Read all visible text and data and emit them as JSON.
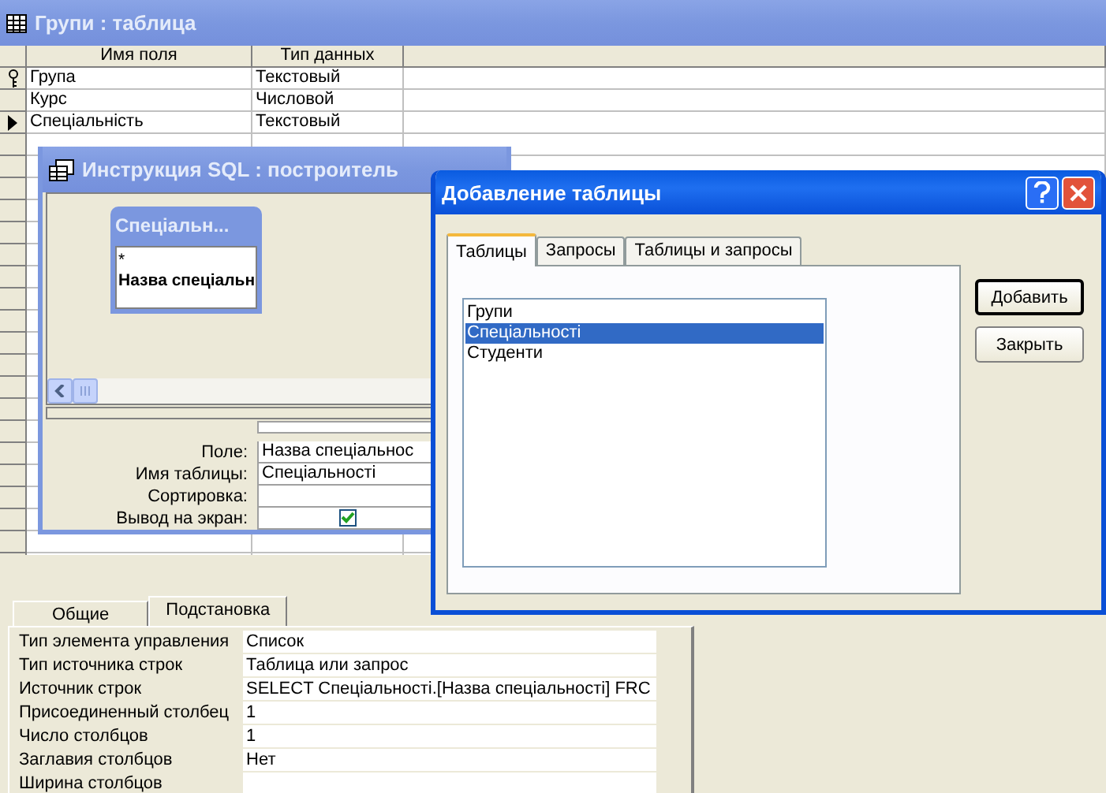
{
  "table_window": {
    "title": "Групи : таблица",
    "columns": [
      "Имя поля",
      "Тип данных"
    ],
    "rows": [
      {
        "name": "Група",
        "type": "Текстовый",
        "key": true,
        "current": false
      },
      {
        "name": "Курс",
        "type": "Числовой",
        "key": false,
        "current": false
      },
      {
        "name": "Спеціальність",
        "type": "Текстовый",
        "key": false,
        "current": true
      }
    ],
    "property_tabs": [
      {
        "label": "Общие",
        "selected": false
      },
      {
        "label": "Подстановка",
        "selected": true
      }
    ],
    "properties": [
      {
        "label": "Тип элемента управления",
        "value": "Список"
      },
      {
        "label": "Тип источника строк",
        "value": "Таблица или запрос"
      },
      {
        "label": "Источник строк",
        "value": "SELECT Спеціальності.[Назва спеціальності] FRC"
      },
      {
        "label": "Присоединенный столбец",
        "value": "1"
      },
      {
        "label": "Число столбцов",
        "value": "1"
      },
      {
        "label": "Заглавия столбцов",
        "value": "Нет"
      },
      {
        "label": "Ширина столбцов"
      }
    ]
  },
  "query_window": {
    "title": "Инструкция SQL : построитель",
    "field_list": {
      "title": "Спеціальн...",
      "items": [
        {
          "text": "*",
          "bold": false
        },
        {
          "text": "Назва спеціальн",
          "bold": true
        }
      ]
    },
    "grid": [
      {
        "label": "Поле:",
        "kind": "text",
        "value": "Назва спеціальнос"
      },
      {
        "label": "Имя таблицы:",
        "kind": "text",
        "value": "Спеціальності"
      },
      {
        "label": "Сортировка:",
        "kind": "text"
      },
      {
        "label": "Вывод на экран:",
        "kind": "checkbox",
        "checked": true
      }
    ]
  },
  "dialog": {
    "title": "Добавление таблицы",
    "tabs": [
      {
        "label": "Таблицы",
        "selected": true
      },
      {
        "label": "Запросы",
        "selected": false
      },
      {
        "label": "Таблицы и запросы",
        "selected": false
      }
    ],
    "tables": [
      {
        "name": "Групи",
        "selected": false
      },
      {
        "name": "Спеціальності",
        "selected": true
      },
      {
        "name": "Студенти",
        "selected": false
      }
    ],
    "buttons": [
      {
        "label": "Добавить",
        "default": true
      },
      {
        "label": "Закрыть",
        "default": false
      }
    ]
  }
}
